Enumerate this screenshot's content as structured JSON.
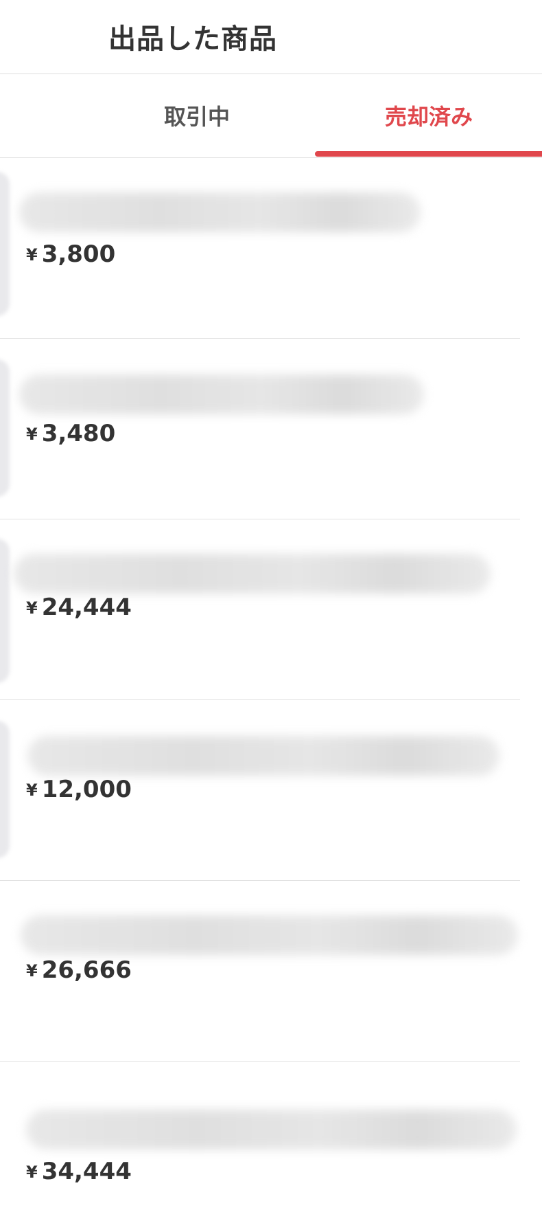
{
  "header": {
    "title": "出品した商品"
  },
  "tabs": [
    {
      "label": "取引中",
      "active": false
    },
    {
      "label": "売却済み",
      "active": true
    }
  ],
  "colors": {
    "accent": "#e0474c",
    "text": "#333333",
    "divider": "#e2e2e2"
  },
  "items": [
    {
      "currency": "¥",
      "price": "3,800"
    },
    {
      "currency": "¥",
      "price": "3,480"
    },
    {
      "currency": "¥",
      "price": "24,444"
    },
    {
      "currency": "¥",
      "price": "12,000"
    },
    {
      "currency": "¥",
      "price": "26,666"
    },
    {
      "currency": "¥",
      "price": "34,444"
    }
  ]
}
